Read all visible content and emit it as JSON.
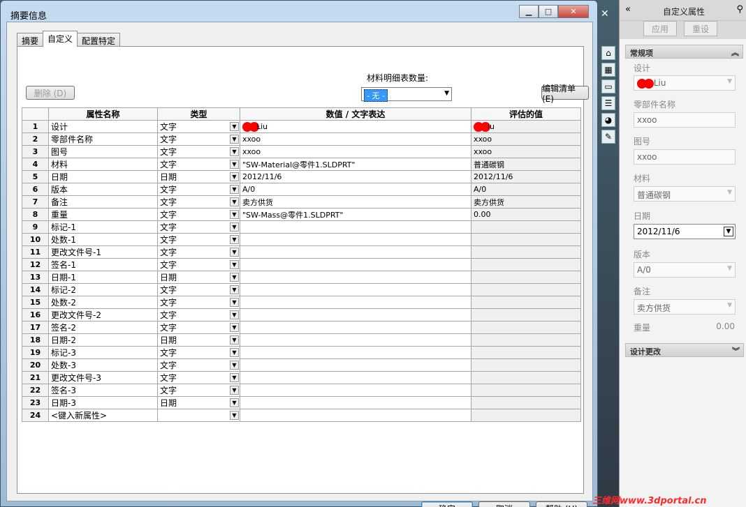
{
  "dialog": {
    "title": "摘要信息",
    "tabs": [
      "摘要",
      "自定义",
      "配置特定"
    ],
    "bom_label": "材料明细表数量:",
    "bom_value": "- 无 -",
    "delete_btn": "删除 (D)",
    "edit_btn": "编辑清单 (E)",
    "ok": "确定",
    "cancel": "取消",
    "help": "帮助 (H)"
  },
  "grid": {
    "headers": [
      "属性名称",
      "类型",
      "数值 / 文字表达",
      "评估的值"
    ],
    "rows": [
      {
        "n": "1",
        "name": "设计",
        "type": "文字",
        "value": "Liu",
        "eval": "iu"
      },
      {
        "n": "2",
        "name": "零部件名称",
        "type": "文字",
        "value": "xxoo",
        "eval": "xxoo"
      },
      {
        "n": "3",
        "name": "图号",
        "type": "文字",
        "value": "xxoo",
        "eval": "xxoo"
      },
      {
        "n": "4",
        "name": "材料",
        "type": "文字",
        "value": "\"SW-Material@零件1.SLDPRT\"",
        "eval": "普通碳钢"
      },
      {
        "n": "5",
        "name": "日期",
        "type": "日期",
        "value": "2012/11/6",
        "eval": "2012/11/6"
      },
      {
        "n": "6",
        "name": "版本",
        "type": "文字",
        "value": "A/0",
        "eval": "A/0"
      },
      {
        "n": "7",
        "name": "备注",
        "type": "文字",
        "value": "卖方供货",
        "eval": "卖方供货"
      },
      {
        "n": "8",
        "name": "重量",
        "type": "文字",
        "value": "\"SW-Mass@零件1.SLDPRT\"",
        "eval": "0.00"
      },
      {
        "n": "9",
        "name": "标记-1",
        "type": "文字",
        "value": "",
        "eval": ""
      },
      {
        "n": "10",
        "name": "处数-1",
        "type": "文字",
        "value": "",
        "eval": ""
      },
      {
        "n": "11",
        "name": "更改文件号-1",
        "type": "文字",
        "value": "",
        "eval": ""
      },
      {
        "n": "12",
        "name": "签名-1",
        "type": "文字",
        "value": "",
        "eval": ""
      },
      {
        "n": "13",
        "name": "日期-1",
        "type": "日期",
        "value": "",
        "eval": ""
      },
      {
        "n": "14",
        "name": "标记-2",
        "type": "文字",
        "value": "",
        "eval": ""
      },
      {
        "n": "15",
        "name": "处数-2",
        "type": "文字",
        "value": "",
        "eval": ""
      },
      {
        "n": "16",
        "name": "更改文件号-2",
        "type": "文字",
        "value": "",
        "eval": ""
      },
      {
        "n": "17",
        "name": "签名-2",
        "type": "文字",
        "value": "",
        "eval": ""
      },
      {
        "n": "18",
        "name": "日期-2",
        "type": "日期",
        "value": "",
        "eval": ""
      },
      {
        "n": "19",
        "name": "标记-3",
        "type": "文字",
        "value": "",
        "eval": ""
      },
      {
        "n": "20",
        "name": "处数-3",
        "type": "文字",
        "value": "",
        "eval": ""
      },
      {
        "n": "21",
        "name": "更改文件号-3",
        "type": "文字",
        "value": "",
        "eval": ""
      },
      {
        "n": "22",
        "name": "签名-3",
        "type": "文字",
        "value": "",
        "eval": ""
      },
      {
        "n": "23",
        "name": "日期-3",
        "type": "日期",
        "value": "",
        "eval": ""
      },
      {
        "n": "24",
        "name": "<键入新属性>",
        "type": "",
        "value": "",
        "eval": ""
      }
    ]
  },
  "pane": {
    "title": "自定义属性",
    "apply": "应用",
    "reset": "重设",
    "section1": "常规项",
    "section2": "设计更改",
    "fields": {
      "design_label": "设计",
      "design_value": "Liu",
      "part_label": "零部件名称",
      "part_value": "xxoo",
      "drawing_label": "图号",
      "drawing_value": "xxoo",
      "material_label": "材料",
      "material_value": "普通碳钢",
      "date_label": "日期",
      "date_value": "2012/11/6",
      "version_label": "版本",
      "version_value": "A/0",
      "note_label": "备注",
      "note_value": "卖方供货",
      "weight_label": "重量",
      "weight_value": "0.00"
    }
  },
  "watermark": "三维网www.3dportal.cn"
}
